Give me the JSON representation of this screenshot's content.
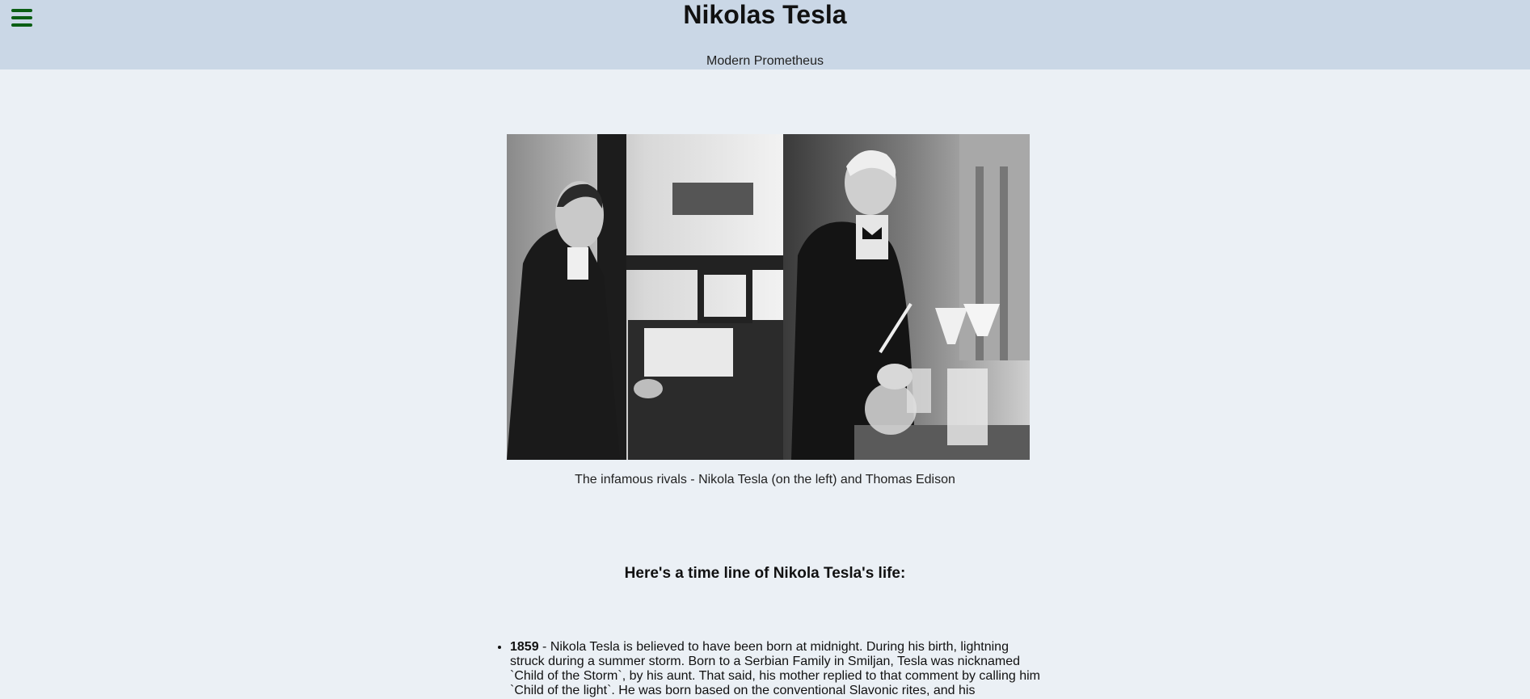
{
  "header": {
    "title": "Nikolas Tesla",
    "subtitle": "Modern Prometheus"
  },
  "figure": {
    "caption": "The infamous rivals - Nikola Tesla (on the left) and Thomas Edison"
  },
  "timeline": {
    "heading": "Here's a time line of Nikola Tesla's life:",
    "items": [
      {
        "year": "1859",
        "text": " - Nikola Tesla is believed to have been born at midnight. During his birth, lightning struck during a summer storm. Born to a Serbian Family in Smiljan, Tesla was nicknamed `Child of the Storm`, by his aunt. That said, his mother replied to that comment by calling him `Child of the light`. He was born based on the conventional Slavonic rites, and his"
      }
    ]
  }
}
